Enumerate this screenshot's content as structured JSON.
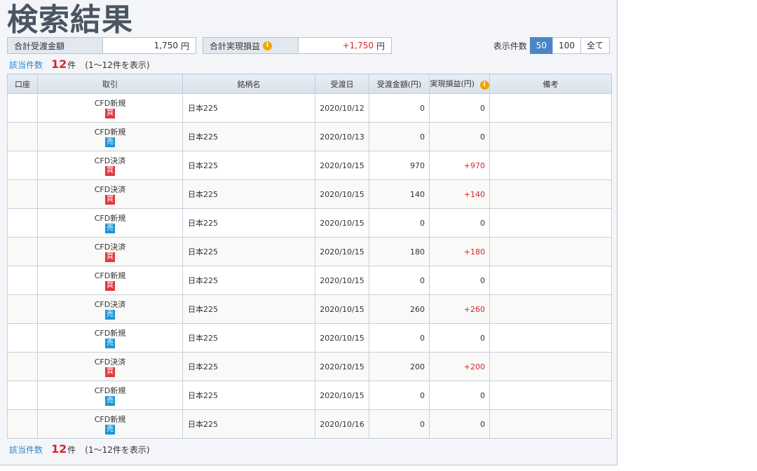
{
  "page": {
    "title": "検索結果"
  },
  "summary": {
    "total_transfer": {
      "label": "合計受渡金額",
      "value": "1,750",
      "unit": "円"
    },
    "realized_pl": {
      "label": "合計実現損益",
      "value": "+1,750",
      "unit": "円",
      "info_icon": "info-icon"
    }
  },
  "perpage": {
    "label": "表示件数",
    "options": [
      "50",
      "100",
      "全て"
    ],
    "selected": "50"
  },
  "count": {
    "label": "該当件数",
    "number": "12",
    "unit": "件",
    "range": "(1〜12件を表示)"
  },
  "table": {
    "headers": {
      "account": "口座",
      "trade": "取引",
      "symbol": "銘柄名",
      "date": "受渡日",
      "amount": "受渡金額(円)",
      "pl": "実現損益(円)",
      "note": "備考"
    },
    "rows": [
      {
        "account": "",
        "trade": "CFD新規",
        "side": "買",
        "side_type": "buy",
        "symbol": "日本225",
        "date": "2020/10/12",
        "amount": "0",
        "pl": "0",
        "note": ""
      },
      {
        "account": "",
        "trade": "CFD新規",
        "side": "売",
        "side_type": "sell",
        "symbol": "日本225",
        "date": "2020/10/13",
        "amount": "0",
        "pl": "0",
        "note": ""
      },
      {
        "account": "",
        "trade": "CFD決済",
        "side": "買",
        "side_type": "buy",
        "symbol": "日本225",
        "date": "2020/10/15",
        "amount": "970",
        "pl": "+970",
        "note": ""
      },
      {
        "account": "",
        "trade": "CFD決済",
        "side": "買",
        "side_type": "buy",
        "symbol": "日本225",
        "date": "2020/10/15",
        "amount": "140",
        "pl": "+140",
        "note": ""
      },
      {
        "account": "",
        "trade": "CFD新規",
        "side": "売",
        "side_type": "sell",
        "symbol": "日本225",
        "date": "2020/10/15",
        "amount": "0",
        "pl": "0",
        "note": ""
      },
      {
        "account": "",
        "trade": "CFD決済",
        "side": "買",
        "side_type": "buy",
        "symbol": "日本225",
        "date": "2020/10/15",
        "amount": "180",
        "pl": "+180",
        "note": ""
      },
      {
        "account": "",
        "trade": "CFD新規",
        "side": "買",
        "side_type": "buy",
        "symbol": "日本225",
        "date": "2020/10/15",
        "amount": "0",
        "pl": "0",
        "note": ""
      },
      {
        "account": "",
        "trade": "CFD決済",
        "side": "売",
        "side_type": "sell",
        "symbol": "日本225",
        "date": "2020/10/15",
        "amount": "260",
        "pl": "+260",
        "note": ""
      },
      {
        "account": "",
        "trade": "CFD新規",
        "side": "売",
        "side_type": "sell",
        "symbol": "日本225",
        "date": "2020/10/15",
        "amount": "0",
        "pl": "0",
        "note": ""
      },
      {
        "account": "",
        "trade": "CFD決済",
        "side": "買",
        "side_type": "buy",
        "symbol": "日本225",
        "date": "2020/10/15",
        "amount": "200",
        "pl": "+200",
        "note": ""
      },
      {
        "account": "",
        "trade": "CFD新規",
        "side": "売",
        "side_type": "sell",
        "symbol": "日本225",
        "date": "2020/10/15",
        "amount": "0",
        "pl": "0",
        "note": ""
      },
      {
        "account": "",
        "trade": "CFD新規",
        "side": "売",
        "side_type": "sell",
        "symbol": "日本225",
        "date": "2020/10/16",
        "amount": "0",
        "pl": "0",
        "note": ""
      }
    ]
  },
  "colors": {
    "accent": "#4a86c5",
    "positive": "#d8262c",
    "buy": "#e0393f",
    "sell": "#1a96dc",
    "link": "#2a8ad0"
  }
}
